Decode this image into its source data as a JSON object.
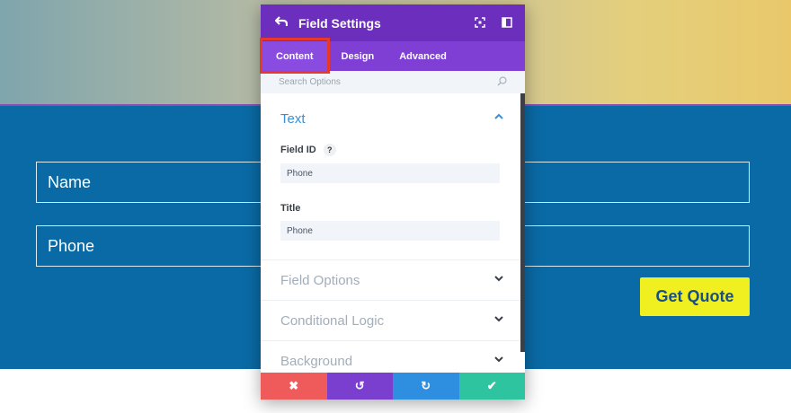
{
  "page": {
    "fields": [
      {
        "label": "Name"
      },
      {
        "label": "Phone"
      }
    ],
    "quote_button": "Get Quote"
  },
  "modal": {
    "title": "Field Settings",
    "tabs": [
      {
        "label": "Content",
        "active": true
      },
      {
        "label": "Design"
      },
      {
        "label": "Advanced"
      }
    ],
    "search": {
      "placeholder": "Search Options"
    },
    "open_section": {
      "title": "Text",
      "field_id": {
        "label": "Field ID",
        "help": "?",
        "value": "Phone"
      },
      "title_field": {
        "label": "Title",
        "value": "Phone"
      }
    },
    "closed_sections": [
      {
        "title": "Field Options"
      },
      {
        "title": "Conditional Logic"
      },
      {
        "title": "Background"
      }
    ],
    "footer": {
      "cancel": "✖",
      "undo": "↺",
      "redo": "↻",
      "save": "✔"
    }
  },
  "colors": {
    "header": "#6c2ebd",
    "tabs": "#7f3fd4",
    "section_blue": "#0a6aa5",
    "quote_button": "#f0ef1f",
    "highlight": "#e8372b"
  }
}
